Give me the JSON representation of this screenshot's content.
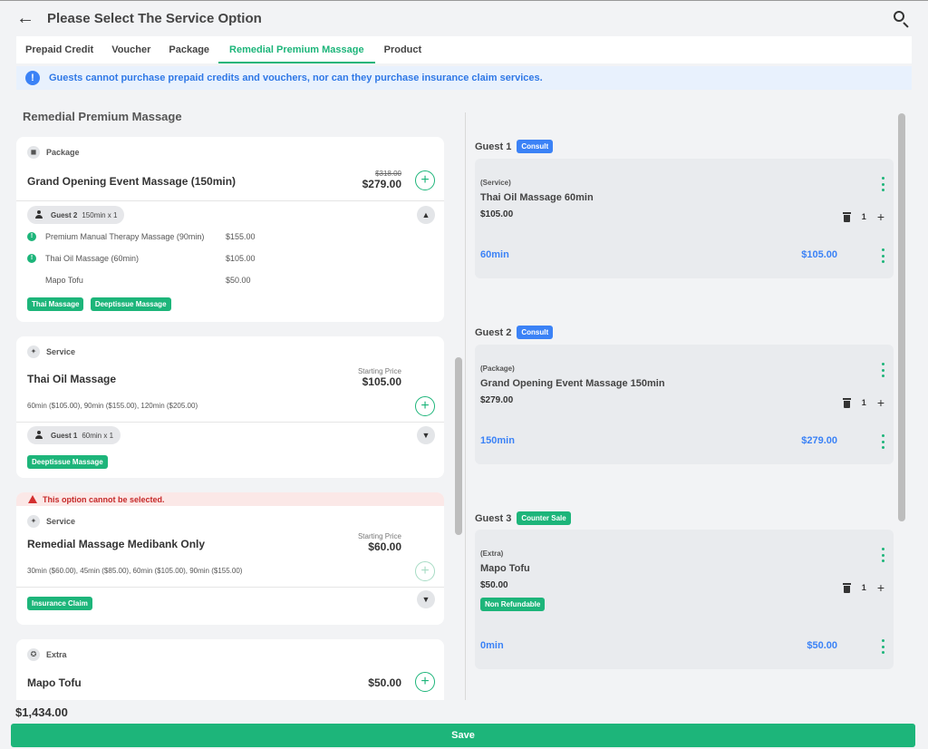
{
  "header": {
    "title": "Please Select The Service Option",
    "back_icon": "arrow-left-icon",
    "search_icon": "search-icon"
  },
  "tabs": [
    {
      "label": "Prepaid Credit",
      "active": false
    },
    {
      "label": "Voucher",
      "active": false
    },
    {
      "label": "Package",
      "active": false
    },
    {
      "label": "Remedial Premium Massage",
      "active": true
    },
    {
      "label": "Product",
      "active": false
    }
  ],
  "notice": {
    "icon": "!",
    "text": "Guests cannot purchase prepaid credits and vouchers, nor can they purchase insurance claim services."
  },
  "left": {
    "section_title": "Remedial Premium Massage",
    "cards": [
      {
        "type": "Package",
        "title": "Grand Opening Event Massage (150min)",
        "old_price": "$318.00",
        "price": "$279.00",
        "guest": {
          "name": "Guest 2",
          "detail": "150min x 1"
        },
        "items": [
          {
            "name": "Premium Manual Therapy Massage (90min)",
            "price": "$155.00",
            "warn": true
          },
          {
            "name": "Thai Oil Massage (60min)",
            "price": "$105.00",
            "warn": true
          },
          {
            "name": "Mapo Tofu",
            "price": "$50.00",
            "warn": false
          }
        ],
        "tags": [
          "Thai Massage",
          "Deeptissue Massage"
        ]
      },
      {
        "type": "Service",
        "title": "Thai Oil Massage",
        "price_label": "Starting Price",
        "price": "$105.00",
        "options": "60min ($105.00), 90min ($155.00), 120min ($205.00)",
        "guest": {
          "name": "Guest 1",
          "detail": "60min x 1"
        },
        "tags": [
          "Deeptissue Massage"
        ]
      },
      {
        "disabled_text": "This option cannot be selected.",
        "type": "Service",
        "title": "Remedial Massage Medibank Only",
        "price_label": "Starting Price",
        "price": "$60.00",
        "options": "30min ($60.00), 45min ($85.00), 60min ($105.00), 90min ($155.00)",
        "tags": [
          "Insurance Claim"
        ]
      },
      {
        "type": "Extra",
        "title": "Mapo Tofu",
        "price": "$50.00"
      }
    ]
  },
  "guests": [
    {
      "label": "Guest 1",
      "badge": "Consult",
      "badge_color": "#3b82f6",
      "item_type": "(Service)",
      "item_name": "Thai Oil Massage 60min",
      "price": "$105.00",
      "qty": "1",
      "duration": "60min",
      "total": "$105.00"
    },
    {
      "label": "Guest 2",
      "badge": "Consult",
      "badge_color": "#3b82f6",
      "item_type": "(Package)",
      "item_name": "Grand Opening Event Massage 150min",
      "price": "$279.00",
      "qty": "1",
      "duration": "150min",
      "total": "$279.00"
    },
    {
      "label": "Guest 3",
      "badge": "Counter Sale",
      "badge_color": "#1db57a",
      "item_type": "(Extra)",
      "item_name": "Mapo Tofu",
      "price": "$50.00",
      "qty": "1",
      "tag": "Non Refundable",
      "duration": "0min",
      "total": "$50.00"
    }
  ],
  "footer": {
    "total": "$1,434.00",
    "save_label": "Save"
  },
  "colors": {
    "accent": "#1db57a",
    "info": "#3b82f6",
    "danger": "#c62828"
  }
}
